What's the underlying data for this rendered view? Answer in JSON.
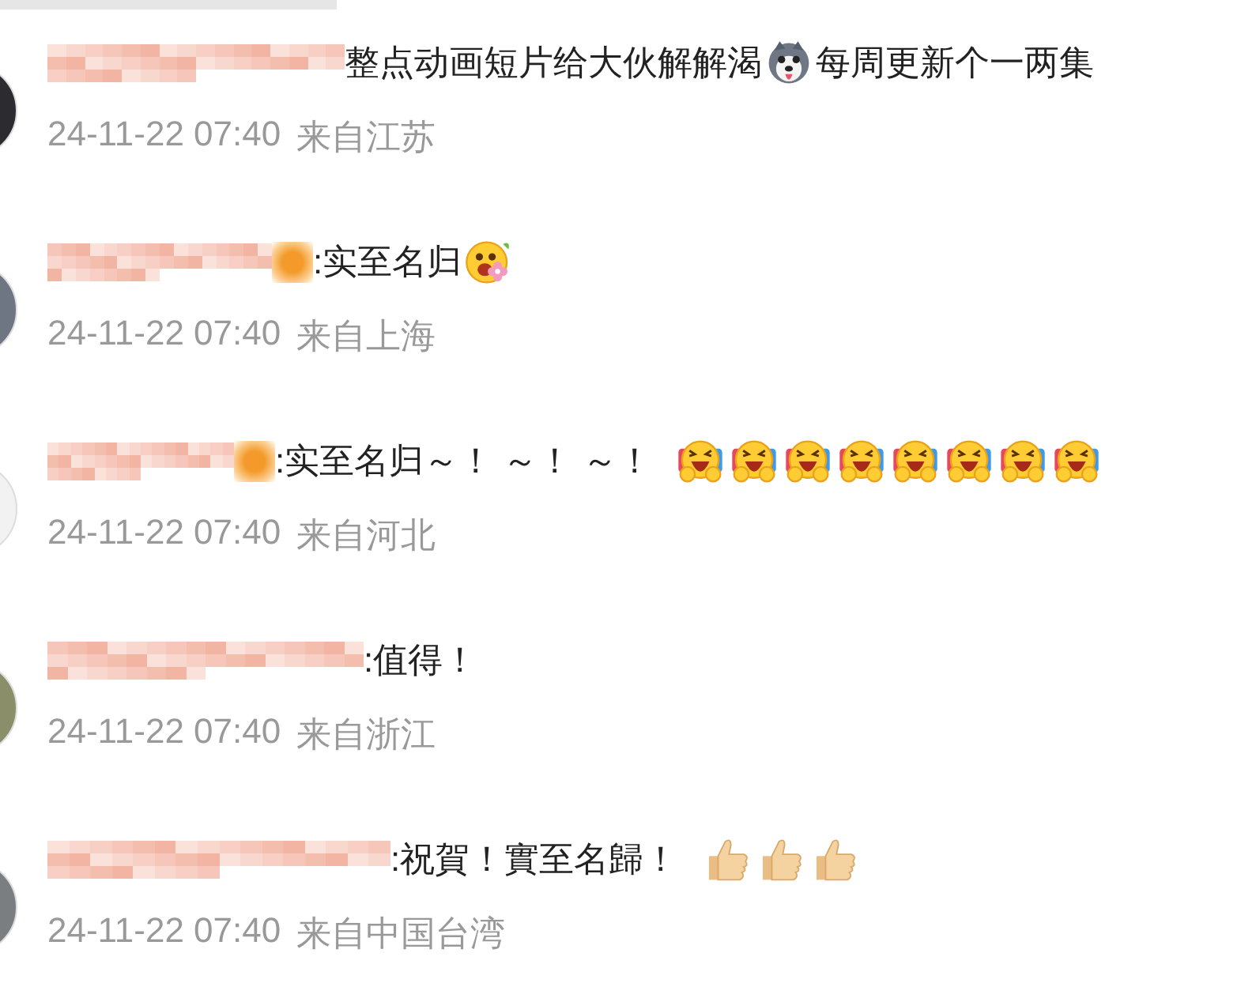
{
  "comments": [
    {
      "color": "#2b2b30",
      "name_redacted": true,
      "badge": false,
      "content": [
        {
          "kind": "text",
          "text": "整点动画短片给大伙解解渴"
        },
        {
          "kind": "husky"
        },
        {
          "kind": "text",
          "text": "每周更新个一两集"
        }
      ],
      "time": "24-11-22 07:40",
      "location": "来自江苏"
    },
    {
      "color": "#6d7682",
      "name_redacted": true,
      "badge": true,
      "content": [
        {
          "kind": "text",
          "text": ":实至名归"
        },
        {
          "kind": "flower"
        }
      ],
      "time": "24-11-22 07:40",
      "location": "来自上海"
    },
    {
      "color": "#f2f2f2",
      "name_redacted": true,
      "badge": true,
      "content": [
        {
          "kind": "text",
          "text": ":实至名归～！ ～！ ～！"
        },
        {
          "kind": "cheer"
        },
        {
          "kind": "cheer"
        },
        {
          "kind": "cheer"
        },
        {
          "kind": "cheer"
        },
        {
          "kind": "cheer"
        },
        {
          "kind": "cheer"
        },
        {
          "kind": "cheer"
        },
        {
          "kind": "cheer"
        }
      ],
      "time": "24-11-22 07:40",
      "location": "来自河北"
    },
    {
      "color": "#8a8f6a",
      "name_redacted": true,
      "badge": false,
      "content": [
        {
          "kind": "text",
          "text": ":值得！"
        }
      ],
      "time": "24-11-22 07:40",
      "location": "来自浙江"
    },
    {
      "color": "#7b7e80",
      "name_redacted": true,
      "badge": false,
      "content": [
        {
          "kind": "text",
          "text": ":祝賀！實至名歸！"
        },
        {
          "kind": "thumb"
        },
        {
          "kind": "thumb"
        },
        {
          "kind": "thumb"
        }
      ],
      "time": "24-11-22 07:40",
      "location": "来自中国台湾"
    }
  ]
}
